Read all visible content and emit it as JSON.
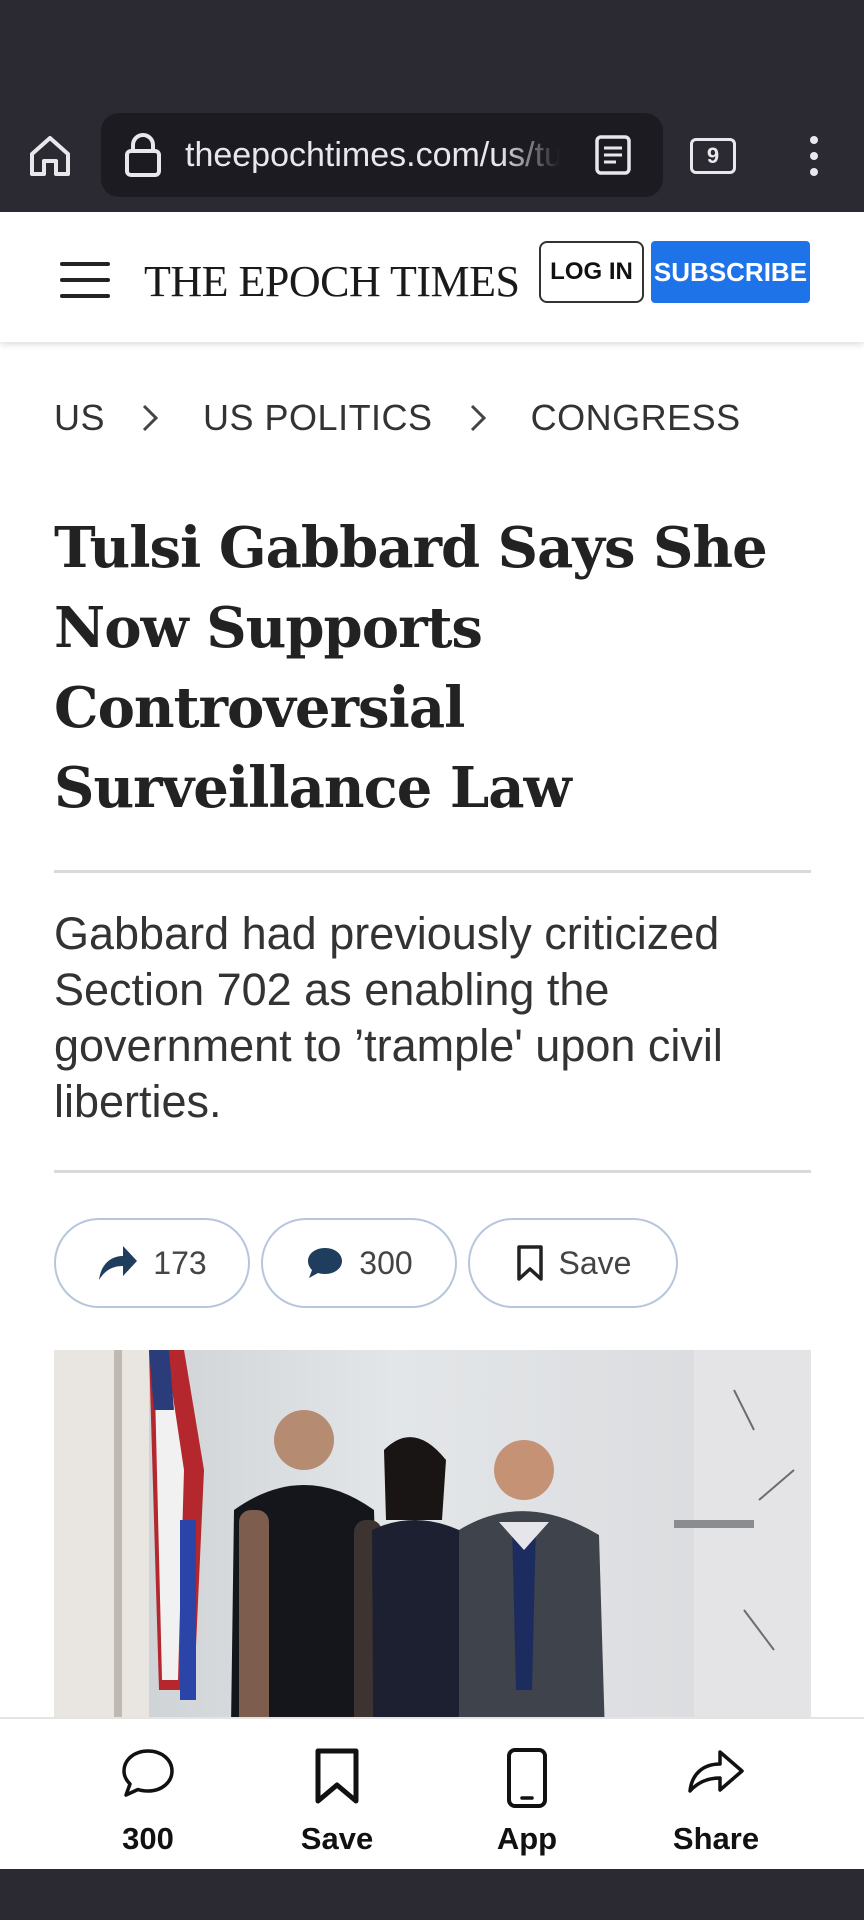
{
  "browser": {
    "url": "theepochtimes.com/us/tulsi-gabbard-says-she-now-supports-controversial-surveillance-law",
    "tab_count": "9"
  },
  "site": {
    "logo": "THE EPOCH TIMES",
    "login_label": "LOG IN",
    "subscribe_label": "SUBSCRIBE"
  },
  "breadcrumb": [
    "US",
    "US POLITICS",
    "CONGRESS"
  ],
  "article": {
    "headline": "Tulsi Gabbard Says She Now Supports Controversial Surveillance Law",
    "subhead": "Gabbard had previously criticized Section 702 as enabling the government to ’trample' upon civil liberties.",
    "share_count": "173",
    "comment_count": "300",
    "save_label": "Save"
  },
  "bottom_bar": {
    "comments_label": "300",
    "save_label": "Save",
    "app_label": "App",
    "share_label": "Share"
  },
  "colors": {
    "accent_blue": "#1e73e8",
    "browser_chrome": "#2b2a33",
    "url_field": "#1c1b22",
    "pill_border": "#b6c6dc",
    "share_icon": "#1f3d5c"
  }
}
